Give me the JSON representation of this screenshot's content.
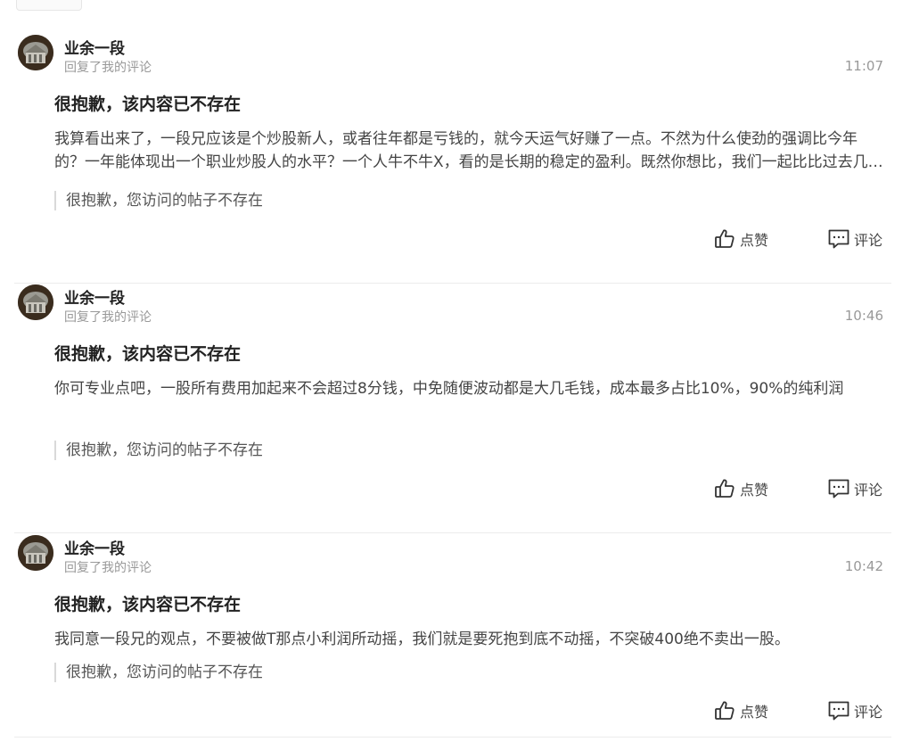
{
  "items": [
    {
      "username": "业余一段",
      "subtext": "回复了我的评论",
      "time": "11:07",
      "title": "很抱歉，该内容已不存在",
      "body": "我算看出来了，一段兄应该是个炒股新人，或者往年都是亏钱的，就今天运气好赚了一点。不然为什么使劲的强调比今年的？一年能体现出一个职业炒股人的水平？一个人牛不牛X，看的是长期的稳定的盈利。既然你想比，我们一起比比过去几年的收益",
      "quote": "很抱歉，您访问的帖子不存在",
      "like_label": "点赞",
      "comment_label": "评论"
    },
    {
      "username": "业余一段",
      "subtext": "回复了我的评论",
      "time": "10:46",
      "title": "很抱歉，该内容已不存在",
      "body": "你可专业点吧，一股所有费用加起来不会超过8分钱，中免随便波动都是大几毛钱，成本最多占比10%，90%的纯利润",
      "quote": "很抱歉，您访问的帖子不存在",
      "like_label": "点赞",
      "comment_label": "评论"
    },
    {
      "username": "业余一段",
      "subtext": "回复了我的评论",
      "time": "10:42",
      "title": "很抱歉，该内容已不存在",
      "body": "我同意一段兄的观点，不要被做T那点小利润所动摇，我们就是要死抱到底不动摇，不突破400绝不卖出一股。",
      "quote": "很抱歉，您访问的帖子不存在",
      "like_label": "点赞",
      "comment_label": "评论"
    }
  ],
  "icons": {
    "like": "thumbs-up-icon",
    "comment": "comment-icon"
  }
}
